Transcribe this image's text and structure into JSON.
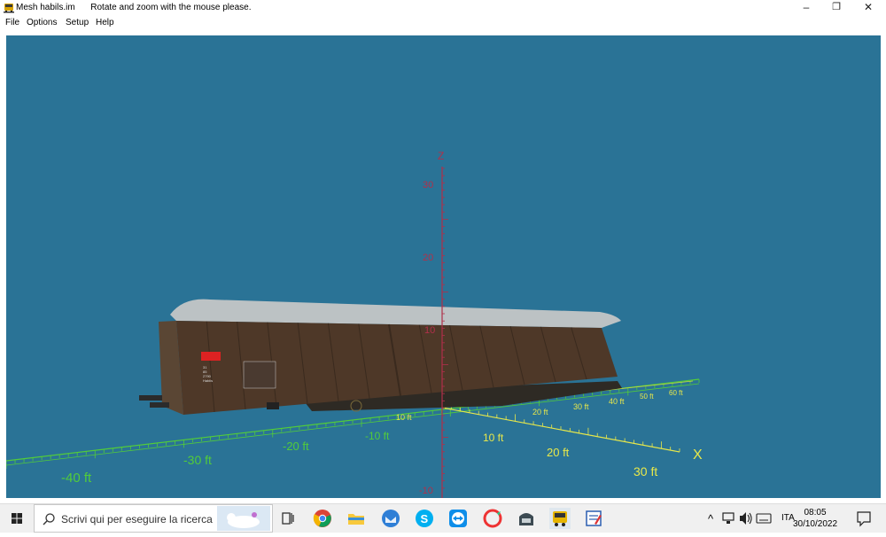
{
  "window": {
    "app_name": "Mesh habils.im",
    "message": "Rotate and zoom with the mouse please.",
    "minimize_glyph": "–",
    "restore_glyph": "❐",
    "close_glyph": "✕"
  },
  "menu": {
    "items": [
      {
        "label": "File"
      },
      {
        "label": "Options"
      },
      {
        "label": "Setup"
      },
      {
        "label": "Help"
      }
    ]
  },
  "viewport": {
    "background_color": "#2a7396",
    "z_axis": {
      "label": "Z",
      "color": "#b0304a",
      "ticks": [
        "30",
        "20",
        "10",
        "-10"
      ]
    },
    "x_axis": {
      "label": "X",
      "color": "#e8e84a",
      "ticks": [
        "10 ft",
        "20 ft",
        "30 ft"
      ],
      "far_ticks": [
        "10 ft",
        "20 ft",
        "30 ft",
        "40 ft",
        "50 ft",
        "60 ft"
      ]
    },
    "y_axis": {
      "color": "#52cc3a",
      "ticks": [
        "-10 ft",
        "-20 ft",
        "-30 ft",
        "-40 ft"
      ]
    },
    "model": {
      "wagon_marking_lines": [
        "31",
        "85",
        "2790",
        "Habiis"
      ]
    }
  },
  "taskbar": {
    "search_placeholder": "Scrivi qui per eseguire la ricerca",
    "language": "ITA",
    "time": "08:05",
    "date": "30/10/2022",
    "chevron_glyph": "^"
  }
}
